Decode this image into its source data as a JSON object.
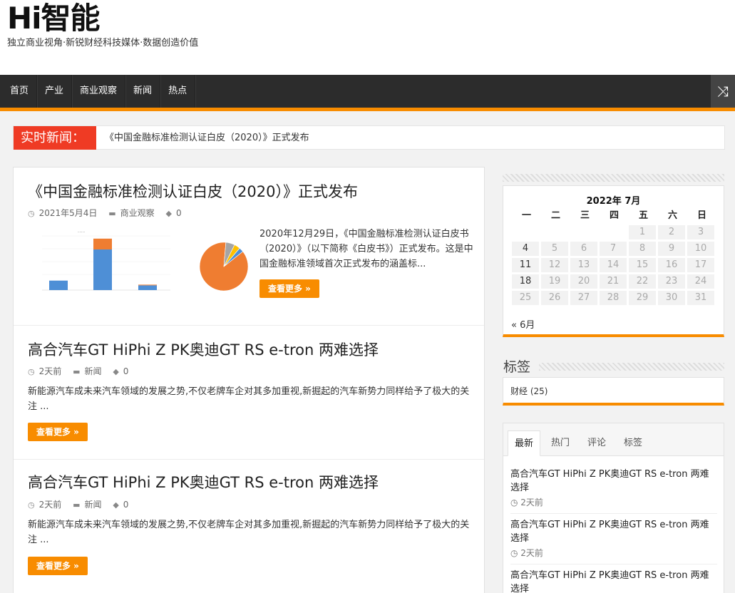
{
  "site": {
    "title": "Hi智能",
    "description": "独立商业视角·新锐财经科技媒体·数据创造价值"
  },
  "nav": {
    "items": [
      "首页",
      "产业",
      "商业观察",
      "新闻",
      "热点"
    ],
    "random_icon": "shuffle-icon"
  },
  "breaking": {
    "label": "实时新闻：",
    "text": "《中国金融标准检测认证白皮（2020）》正式发布"
  },
  "posts": [
    {
      "title": "《中国金融标准检测认证白皮（2020）》正式发布",
      "date": "2021年5月4日",
      "category": "商业观察",
      "comments": "0",
      "excerpt": "2020年12月29日，《中国金融标准检测认证白皮书（2020）》（以下简称《白皮书》）正式发布。这是中国金融标准领域首次正式发布的涵盖标...",
      "more": "查看更多 »"
    },
    {
      "title": "高合汽车GT HiPhi Z PK奥迪GT RS e-tron 两难选择",
      "date": "2天前",
      "category": "新闻",
      "comments": "0",
      "excerpt": "新能源汽车成未来汽车领域的发展之势,不仅老牌车企对其多加重视,新掘起的汽车新势力同样给予了极大的关注 ...",
      "more": "查看更多 »"
    },
    {
      "title": "高合汽车GT HiPhi Z PK奥迪GT RS e-tron 两难选择",
      "date": "2天前",
      "category": "新闻",
      "comments": "0",
      "excerpt": "新能源汽车成未来汽车领域的发展之势,不仅老牌车企对其多加重视,新掘起的汽车新势力同样给予了极大的关注 ...",
      "more": "查看更多 »"
    }
  ],
  "calendar": {
    "caption": "2022年 7月",
    "weekdays": [
      "一",
      "二",
      "三",
      "四",
      "五",
      "六",
      "日"
    ],
    "weeks": [
      [
        "",
        "",
        "",
        "",
        "1",
        "2",
        "3"
      ],
      [
        "4",
        "5",
        "6",
        "7",
        "8",
        "9",
        "10"
      ],
      [
        "11",
        "12",
        "13",
        "14",
        "15",
        "16",
        "17"
      ],
      [
        "18",
        "19",
        "20",
        "21",
        "22",
        "23",
        "24"
      ],
      [
        "25",
        "26",
        "27",
        "28",
        "29",
        "30",
        "31"
      ]
    ],
    "linked_days": [
      "4",
      "11",
      "18"
    ],
    "prev": "« 6月"
  },
  "tags": {
    "title": "标签",
    "item": "财经 (25)"
  },
  "tabs": {
    "labels": [
      "最新",
      "热门",
      "评论",
      "标签"
    ],
    "items": [
      {
        "title": "高合汽车GT HiPhi Z PK奥迪GT RS e-tron 两难选择",
        "date": "2天前"
      },
      {
        "title": "高合汽车GT HiPhi Z PK奥迪GT RS e-tron 两难选择",
        "date": "2天前"
      },
      {
        "title": "高合汽车GT HiPhi Z PK奥迪GT RS e-tron 两难选择",
        "date": ""
      }
    ]
  },
  "colors": {
    "accent": "#f88c00",
    "breaking": "#ef3b24",
    "nav_bg": "#2c2c2c"
  },
  "thumbnail": {
    "bar_values": [
      70,
      300,
      35
    ],
    "bar_stack_top": [
      0,
      80,
      5
    ],
    "pie_slices": [
      87,
      6,
      4,
      3
    ]
  }
}
